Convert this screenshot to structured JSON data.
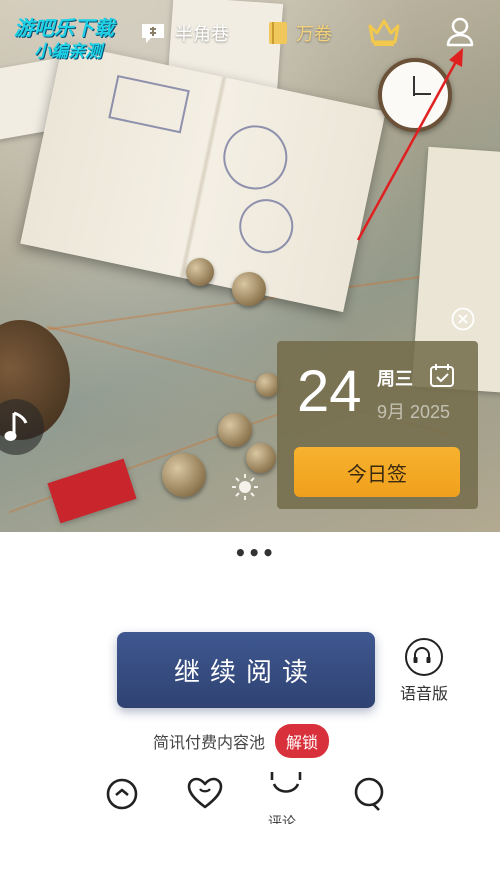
{
  "watermark": {
    "line1": "游吧乐下载",
    "line2": "小编亲测"
  },
  "nav": {
    "tabs": [
      {
        "label": "半角巷",
        "icon": "chat-bubble-icon"
      },
      {
        "label": "万卷",
        "icon": "book-icon"
      }
    ],
    "vip_icon": "crown-icon",
    "profile_icon": "user-icon"
  },
  "sign_card": {
    "day": "24",
    "weekday": "周三",
    "month_year": "9月 2025",
    "button_label": "今日签"
  },
  "main": {
    "continue_label": "继续阅读",
    "audio_label": "语音版",
    "promo_text": "简讯付费内容池",
    "promo_badge": "解锁"
  },
  "bottom_actions": [
    {
      "icon": "meh-face-icon"
    },
    {
      "icon": "heart-icon"
    },
    {
      "icon": "smile-comment-icon",
      "label": "评论"
    },
    {
      "icon": "search-icon"
    }
  ],
  "colors": {
    "accent_blue": "#3a5189",
    "sign_orange": "#f5a623",
    "badge_red": "#d9313b",
    "watermark_cyan": "#1ed2e6",
    "annotation_red": "#e02020"
  }
}
